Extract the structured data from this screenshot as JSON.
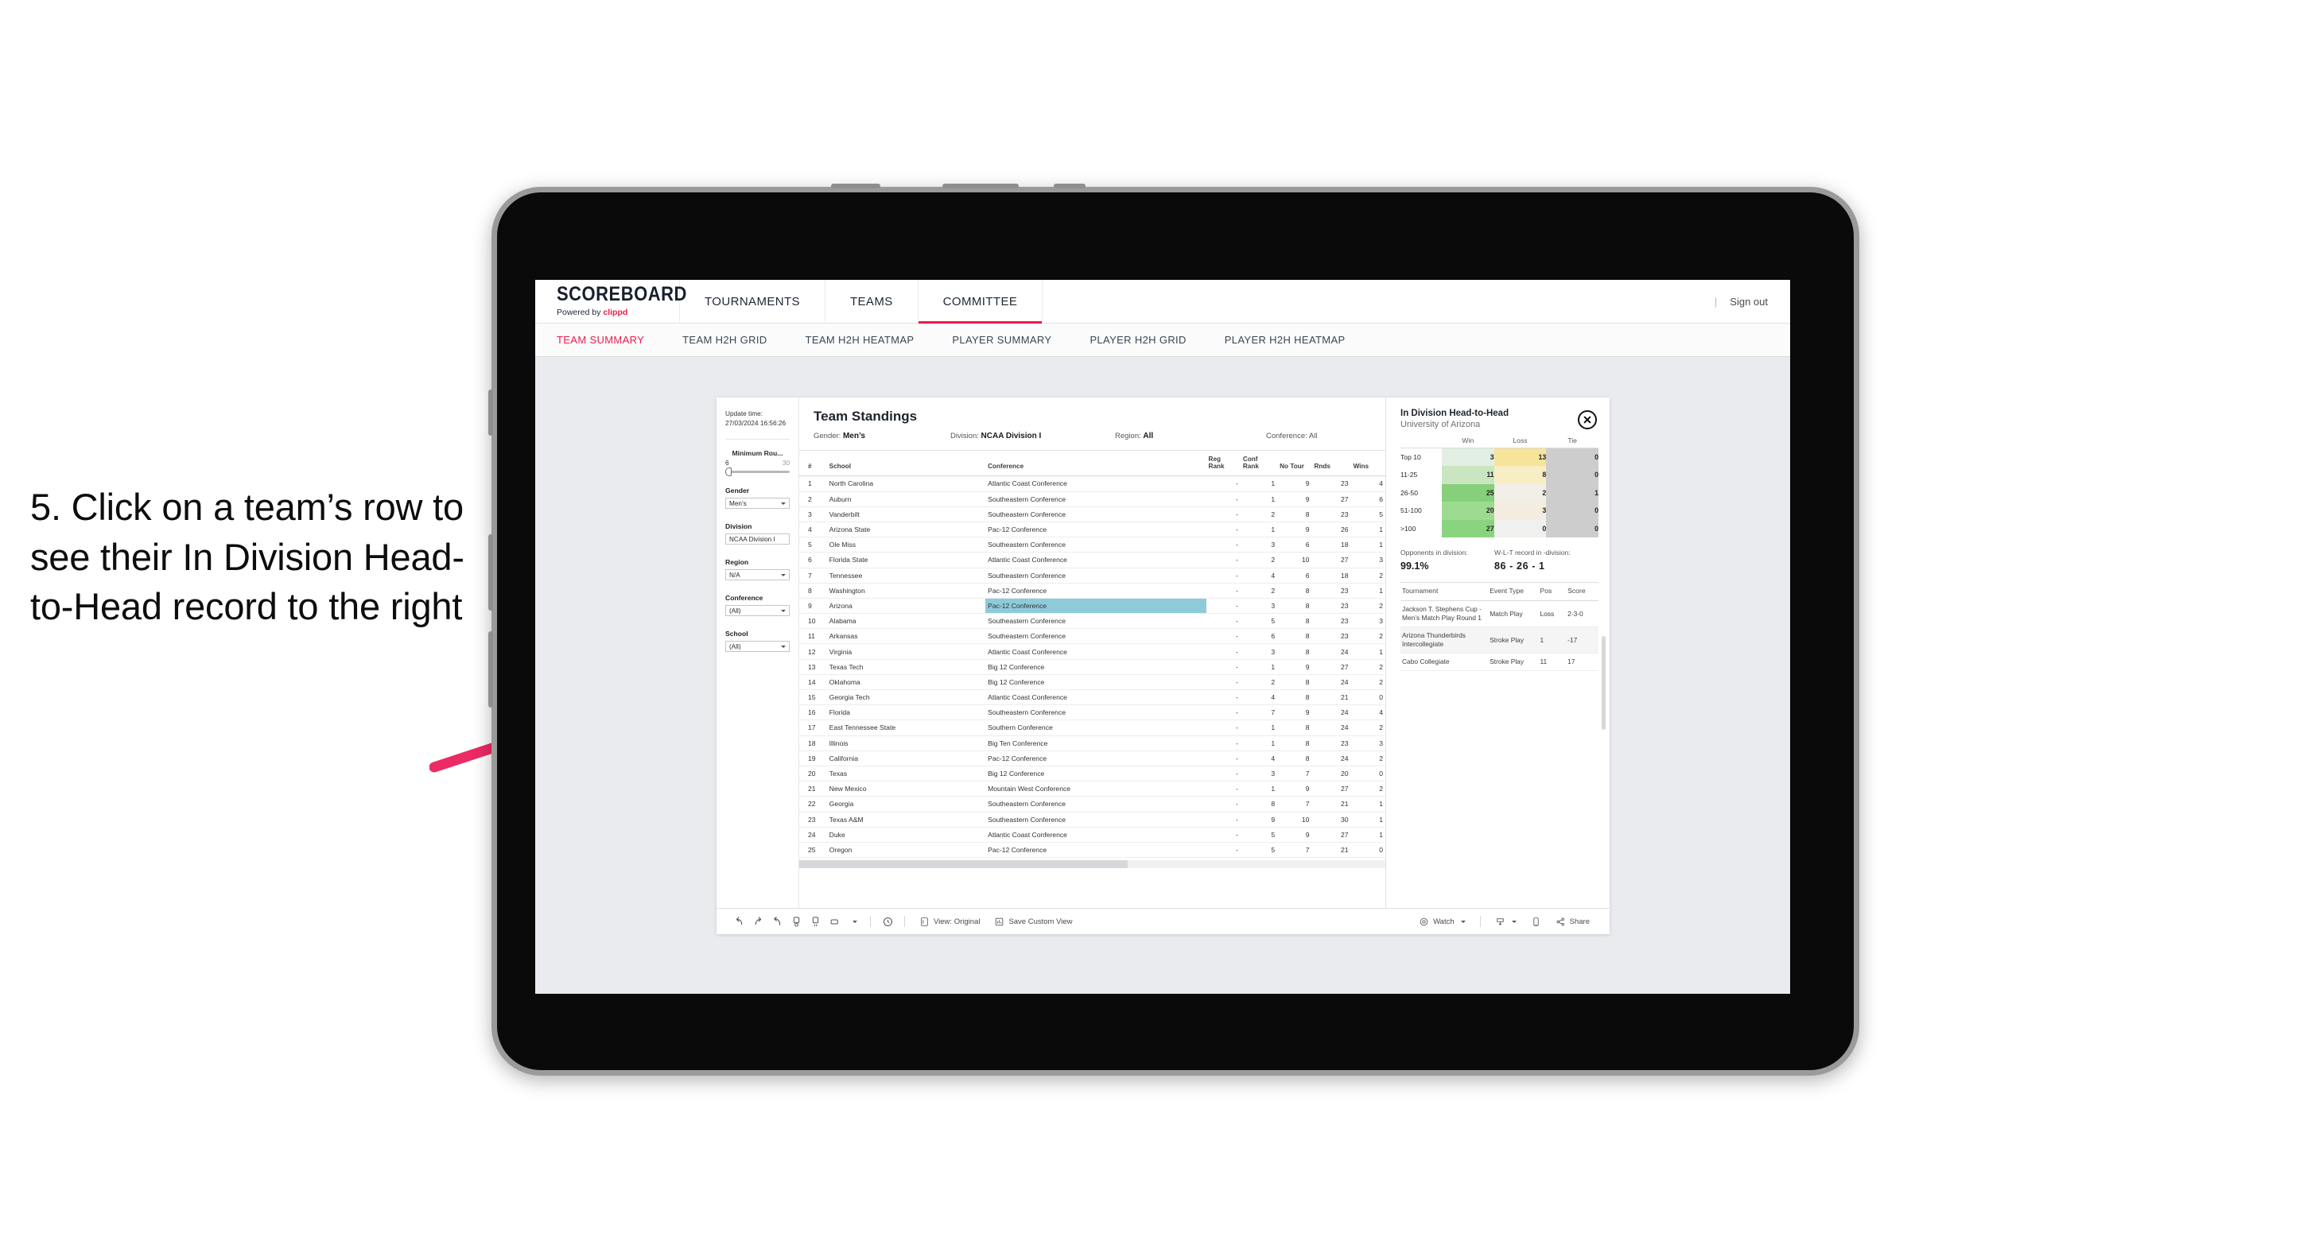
{
  "annotation": {
    "text": "5. Click on a team’s row to see their In Division Head-to-Head record to the right",
    "arrow_color": "#ec2a63"
  },
  "topbar": {
    "logo": "SCOREBOARD",
    "logo_sub_prefix": "Powered by ",
    "logo_sub_brand": "clippd",
    "nav": [
      {
        "label": "TOURNAMENTS",
        "active": false
      },
      {
        "label": "TEAMS",
        "active": false
      },
      {
        "label": "COMMITTEE",
        "active": true
      }
    ],
    "divider": "|",
    "sign_out": "Sign out",
    "accent": "#ec1b4b"
  },
  "subnav": {
    "items": [
      {
        "label": "TEAM SUMMARY",
        "active": true
      },
      {
        "label": "TEAM H2H GRID",
        "active": false
      },
      {
        "label": "TEAM H2H HEATMAP",
        "active": false
      },
      {
        "label": "PLAYER SUMMARY",
        "active": false
      },
      {
        "label": "PLAYER H2H GRID",
        "active": false
      },
      {
        "label": "PLAYER H2H HEATMAP",
        "active": false
      }
    ]
  },
  "filters": {
    "update_time_label": "Update time:",
    "update_time_value": "27/03/2024 16:56:26",
    "min_rounds": {
      "title": "Minimum Rou...",
      "min": "6",
      "max": "30"
    },
    "groups": [
      {
        "label": "Gender",
        "value": "Men’s"
      },
      {
        "label": "Division",
        "value": "NCAA Division I"
      },
      {
        "label": "Region",
        "value": "N/A"
      },
      {
        "label": "Conference",
        "value": "(All)"
      },
      {
        "label": "School",
        "value": "(All)"
      }
    ]
  },
  "standings": {
    "title": "Team Standings",
    "meta": [
      {
        "label": "Gender: ",
        "value": "Men’s"
      },
      {
        "label": "Division: ",
        "value": "NCAA Division I"
      },
      {
        "label": "Region: ",
        "value": "All"
      },
      {
        "label": "Conference: ",
        "value": "All"
      }
    ],
    "columns": [
      "#",
      "School",
      "Conference",
      "Reg Rank",
      "Conf Rank",
      "No Tour",
      "Rnds",
      "Wins"
    ],
    "selected_conference_row": 9,
    "rows": [
      {
        "n": "1",
        "school": "North Carolina",
        "conf": "Atlantic Coast Conference",
        "reg": "-",
        "cr": "1",
        "nt": "9",
        "rnds": "23",
        "wins": "4"
      },
      {
        "n": "2",
        "school": "Auburn",
        "conf": "Southeastern Conference",
        "reg": "-",
        "cr": "1",
        "nt": "9",
        "rnds": "27",
        "wins": "6"
      },
      {
        "n": "3",
        "school": "Vanderbilt",
        "conf": "Southeastern Conference",
        "reg": "-",
        "cr": "2",
        "nt": "8",
        "rnds": "23",
        "wins": "5"
      },
      {
        "n": "4",
        "school": "Arizona State",
        "conf": "Pac-12 Conference",
        "reg": "-",
        "cr": "1",
        "nt": "9",
        "rnds": "26",
        "wins": "1"
      },
      {
        "n": "5",
        "school": "Ole Miss",
        "conf": "Southeastern Conference",
        "reg": "-",
        "cr": "3",
        "nt": "6",
        "rnds": "18",
        "wins": "1"
      },
      {
        "n": "6",
        "school": "Florida State",
        "conf": "Atlantic Coast Conference",
        "reg": "-",
        "cr": "2",
        "nt": "10",
        "rnds": "27",
        "wins": "3"
      },
      {
        "n": "7",
        "school": "Tennessee",
        "conf": "Southeastern Conference",
        "reg": "-",
        "cr": "4",
        "nt": "6",
        "rnds": "18",
        "wins": "2"
      },
      {
        "n": "8",
        "school": "Washington",
        "conf": "Pac-12 Conference",
        "reg": "-",
        "cr": "2",
        "nt": "8",
        "rnds": "23",
        "wins": "1"
      },
      {
        "n": "9",
        "school": "Arizona",
        "conf": "Pac-12 Conference",
        "reg": "-",
        "cr": "3",
        "nt": "8",
        "rnds": "23",
        "wins": "2"
      },
      {
        "n": "10",
        "school": "Alabama",
        "conf": "Southeastern Conference",
        "reg": "-",
        "cr": "5",
        "nt": "8",
        "rnds": "23",
        "wins": "3"
      },
      {
        "n": "11",
        "school": "Arkansas",
        "conf": "Southeastern Conference",
        "reg": "-",
        "cr": "6",
        "nt": "8",
        "rnds": "23",
        "wins": "2"
      },
      {
        "n": "12",
        "school": "Virginia",
        "conf": "Atlantic Coast Conference",
        "reg": "-",
        "cr": "3",
        "nt": "8",
        "rnds": "24",
        "wins": "1"
      },
      {
        "n": "13",
        "school": "Texas Tech",
        "conf": "Big 12 Conference",
        "reg": "-",
        "cr": "1",
        "nt": "9",
        "rnds": "27",
        "wins": "2"
      },
      {
        "n": "14",
        "school": "Oklahoma",
        "conf": "Big 12 Conference",
        "reg": "-",
        "cr": "2",
        "nt": "8",
        "rnds": "24",
        "wins": "2"
      },
      {
        "n": "15",
        "school": "Georgia Tech",
        "conf": "Atlantic Coast Conference",
        "reg": "-",
        "cr": "4",
        "nt": "8",
        "rnds": "21",
        "wins": "0"
      },
      {
        "n": "16",
        "school": "Florida",
        "conf": "Southeastern Conference",
        "reg": "-",
        "cr": "7",
        "nt": "9",
        "rnds": "24",
        "wins": "4"
      },
      {
        "n": "17",
        "school": "East Tennessee State",
        "conf": "Southern Conference",
        "reg": "-",
        "cr": "1",
        "nt": "8",
        "rnds": "24",
        "wins": "2"
      },
      {
        "n": "18",
        "school": "Illinois",
        "conf": "Big Ten Conference",
        "reg": "-",
        "cr": "1",
        "nt": "8",
        "rnds": "23",
        "wins": "3"
      },
      {
        "n": "19",
        "school": "California",
        "conf": "Pac-12 Conference",
        "reg": "-",
        "cr": "4",
        "nt": "8",
        "rnds": "24",
        "wins": "2"
      },
      {
        "n": "20",
        "school": "Texas",
        "conf": "Big 12 Conference",
        "reg": "-",
        "cr": "3",
        "nt": "7",
        "rnds": "20",
        "wins": "0"
      },
      {
        "n": "21",
        "school": "New Mexico",
        "conf": "Mountain West Conference",
        "reg": "-",
        "cr": "1",
        "nt": "9",
        "rnds": "27",
        "wins": "2"
      },
      {
        "n": "22",
        "school": "Georgia",
        "conf": "Southeastern Conference",
        "reg": "-",
        "cr": "8",
        "nt": "7",
        "rnds": "21",
        "wins": "1"
      },
      {
        "n": "23",
        "school": "Texas A&M",
        "conf": "Southeastern Conference",
        "reg": "-",
        "cr": "9",
        "nt": "10",
        "rnds": "30",
        "wins": "1"
      },
      {
        "n": "24",
        "school": "Duke",
        "conf": "Atlantic Coast Conference",
        "reg": "-",
        "cr": "5",
        "nt": "9",
        "rnds": "27",
        "wins": "1"
      },
      {
        "n": "25",
        "school": "Oregon",
        "conf": "Pac-12 Conference",
        "reg": "-",
        "cr": "5",
        "nt": "7",
        "rnds": "21",
        "wins": "0"
      }
    ]
  },
  "h2h": {
    "title": "In Division Head-to-Head",
    "subtitle": "University of Arizona",
    "close_icon": "close-icon",
    "matrix": {
      "columns": [
        "Win",
        "Loss",
        "Tie"
      ],
      "buckets": [
        "Top 10",
        "11-25",
        "26-50",
        "51-100",
        ">100"
      ],
      "win": [
        "3",
        "11",
        "25",
        "20",
        "27"
      ],
      "loss": [
        "13",
        "8",
        "2",
        "3",
        "0"
      ],
      "tie": [
        "0",
        "0",
        "1",
        "0",
        "0"
      ],
      "win_colors": [
        "#e2efe3",
        "#c9e6c0",
        "#86d07c",
        "#9ddb90",
        "#8bd47f"
      ],
      "loss_colors": [
        "#f6e49b",
        "#f7eec4",
        "#f1efe7",
        "#f5ece0",
        "#f0f0ee"
      ],
      "tie_colors": [
        "#cdcdcd",
        "#cdcdcd",
        "#cdcdcd",
        "#cdcdcd",
        "#cdcdcd"
      ]
    },
    "stats": [
      {
        "label": "Opponents in division:",
        "value": "99.1%"
      },
      {
        "label": "W-L-T record in -division:",
        "value": "86 - 26 - 1"
      }
    ],
    "events": {
      "columns": [
        "Tournament",
        "Event Type",
        "Pos",
        "Score"
      ],
      "rows": [
        {
          "tournament": "Jackson T. Stephens Cup - Men’s Match Play Round 1",
          "type": "Match Play",
          "pos": "Loss",
          "score": "2-3-0"
        },
        {
          "tournament": "Arizona Thunderbirds Intercollegiate",
          "type": "Stroke Play",
          "pos": "1",
          "score": "-17"
        },
        {
          "tournament": "Cabo Collegiate",
          "type": "Stroke Play",
          "pos": "11",
          "score": "17"
        }
      ]
    }
  },
  "toolbar": {
    "icons": [
      "undo-icon",
      "redo-icon",
      "revert-icon",
      "refresh-icon",
      "pause-icon",
      "shape-icon"
    ],
    "alerts_icon": "alerts-icon",
    "view_label": "View: Original",
    "save_label": "Save Custom View",
    "watch_label": "Watch",
    "download_icon": "download-icon",
    "device_icon": "device-icon",
    "share_label": "Share"
  }
}
